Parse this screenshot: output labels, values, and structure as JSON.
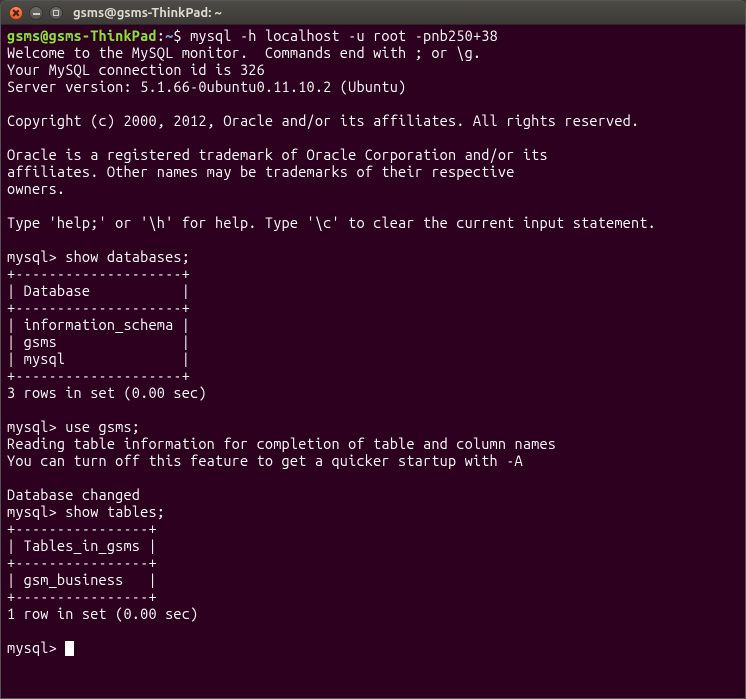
{
  "window": {
    "title": "gsms@gsms-ThinkPad: ~"
  },
  "prompt": {
    "userhost": "gsms@gsms-ThinkPad",
    "sep": ":",
    "path": "~",
    "dollar": "$ "
  },
  "lines": {
    "cmd1": "mysql -h localhost -u root -pnb250+38",
    "welcome1": "Welcome to the MySQL monitor.  Commands end with ; or \\g.",
    "welcome2": "Your MySQL connection id is 326",
    "welcome3": "Server version: 5.1.66-0ubuntu0.11.10.2 (Ubuntu)",
    "copyright": "Copyright (c) 2000, 2012, Oracle and/or its affiliates. All rights reserved.",
    "oracle1": "Oracle is a registered trademark of Oracle Corporation and/or its",
    "oracle2": "affiliates. Other names may be trademarks of their respective",
    "oracle3": "owners.",
    "help": "Type 'help;' or '\\h' for help. Type '\\c' to clear the current input statement.",
    "mysqlprompt": "mysql> ",
    "cmd2": "show databases;",
    "db_border": "+--------------------+",
    "db_header": "| Database           |",
    "db_row1": "| information_schema |",
    "db_row2": "| gsms               |",
    "db_row3": "| mysql              |",
    "db_count": "3 rows in set (0.00 sec)",
    "cmd3": "use gsms;",
    "reading1": "Reading table information for completion of table and column names",
    "reading2": "You can turn off this feature to get a quicker startup with -A",
    "changed": "Database changed",
    "cmd4": "show tables;",
    "tb_border": "+----------------+",
    "tb_header": "| Tables_in_gsms |",
    "tb_row1": "| gsm_business   |",
    "tb_count": "1 row in set (0.00 sec)"
  }
}
